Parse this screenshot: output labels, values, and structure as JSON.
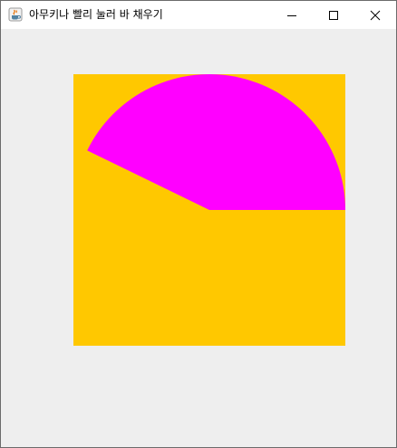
{
  "window": {
    "title": "아무키나 빨리 눌러 바 채우기",
    "app_icon": "java-cup-icon"
  },
  "controls": {
    "minimize_icon": "minimize-icon",
    "maximize_icon": "maximize-icon",
    "close_icon": "close-icon"
  },
  "panel": {
    "background_color": "#FFC800",
    "arc_color": "#FF00FF",
    "arc_start_angle_deg": 0,
    "arc_extent_deg": 154
  }
}
